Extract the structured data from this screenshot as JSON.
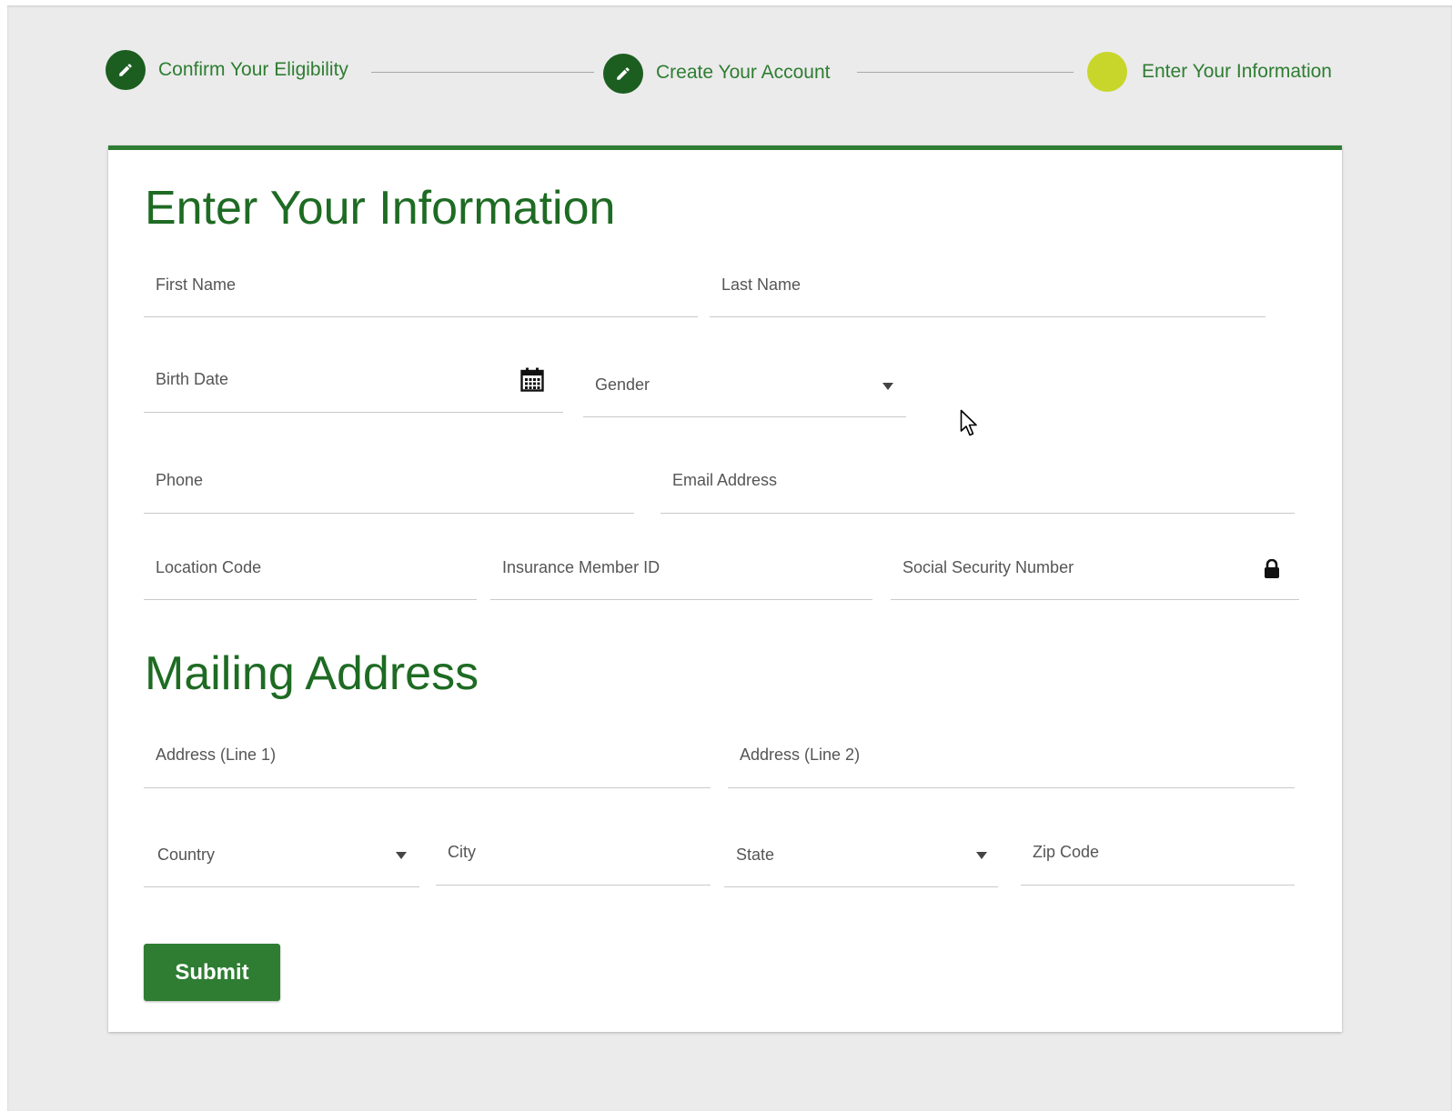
{
  "stepper": {
    "steps": [
      {
        "label": "Confirm Your Eligibility",
        "icon": "pencil-icon",
        "status": "completed"
      },
      {
        "label": "Create Your Account",
        "icon": "pencil-icon",
        "status": "completed"
      },
      {
        "label": "Enter Your Information",
        "icon": "",
        "status": "current"
      }
    ],
    "colors": {
      "completed": "#1b5e20",
      "current": "#c8d62b",
      "label": "#2e7d32"
    }
  },
  "form": {
    "title": "Enter Your Information",
    "fields": {
      "first_name": "First Name",
      "last_name": "Last Name",
      "birth_date": "Birth Date",
      "gender": "Gender",
      "phone": "Phone",
      "email": "Email Address",
      "location_code": "Location Code",
      "insurance_member_id": "Insurance Member ID",
      "ssn": "Social Security Number"
    }
  },
  "mailing": {
    "title": "Mailing Address",
    "fields": {
      "address1": "Address (Line 1)",
      "address2": "Address (Line 2)",
      "country": "Country",
      "city": "City",
      "state": "State",
      "zip": "Zip Code"
    }
  },
  "actions": {
    "submit_label": "Submit"
  },
  "theme": {
    "primary": "#2e7d32",
    "heading": "#1e6b23",
    "background": "#ebebeb"
  }
}
